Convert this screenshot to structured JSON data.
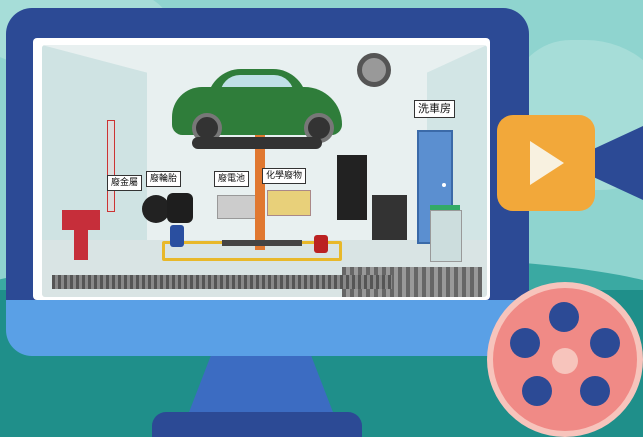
{
  "scene": {
    "labels": {
      "metal": "廢金屬",
      "tires": "廢輪胎",
      "batteries": "廢電池",
      "chemical": "化學廢物",
      "carwash": "洗車房"
    }
  },
  "colors": {
    "monitor_frame": "#2c4a95",
    "monitor_bottom": "#5aa0e6",
    "background": "#8fd4cf",
    "camera": "#f2a83a",
    "reel": "#f08a86",
    "car": "#2f7d3a",
    "lift": "#e07830"
  }
}
